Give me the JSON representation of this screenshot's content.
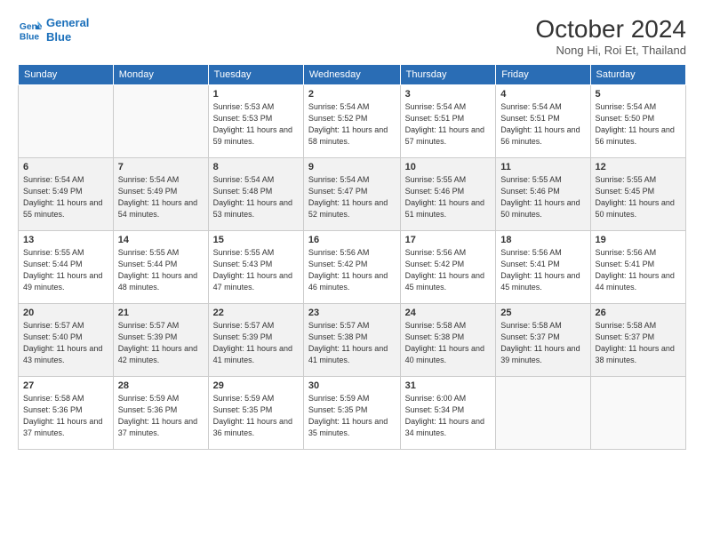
{
  "header": {
    "logo_line1": "General",
    "logo_line2": "Blue",
    "month": "October 2024",
    "location": "Nong Hi, Roi Et, Thailand"
  },
  "weekdays": [
    "Sunday",
    "Monday",
    "Tuesday",
    "Wednesday",
    "Thursday",
    "Friday",
    "Saturday"
  ],
  "weeks": [
    [
      {
        "day": "",
        "info": ""
      },
      {
        "day": "",
        "info": ""
      },
      {
        "day": "1",
        "info": "Sunrise: 5:53 AM\nSunset: 5:53 PM\nDaylight: 11 hours and 59 minutes."
      },
      {
        "day": "2",
        "info": "Sunrise: 5:54 AM\nSunset: 5:52 PM\nDaylight: 11 hours and 58 minutes."
      },
      {
        "day": "3",
        "info": "Sunrise: 5:54 AM\nSunset: 5:51 PM\nDaylight: 11 hours and 57 minutes."
      },
      {
        "day": "4",
        "info": "Sunrise: 5:54 AM\nSunset: 5:51 PM\nDaylight: 11 hours and 56 minutes."
      },
      {
        "day": "5",
        "info": "Sunrise: 5:54 AM\nSunset: 5:50 PM\nDaylight: 11 hours and 56 minutes."
      }
    ],
    [
      {
        "day": "6",
        "info": "Sunrise: 5:54 AM\nSunset: 5:49 PM\nDaylight: 11 hours and 55 minutes."
      },
      {
        "day": "7",
        "info": "Sunrise: 5:54 AM\nSunset: 5:49 PM\nDaylight: 11 hours and 54 minutes."
      },
      {
        "day": "8",
        "info": "Sunrise: 5:54 AM\nSunset: 5:48 PM\nDaylight: 11 hours and 53 minutes."
      },
      {
        "day": "9",
        "info": "Sunrise: 5:54 AM\nSunset: 5:47 PM\nDaylight: 11 hours and 52 minutes."
      },
      {
        "day": "10",
        "info": "Sunrise: 5:55 AM\nSunset: 5:46 PM\nDaylight: 11 hours and 51 minutes."
      },
      {
        "day": "11",
        "info": "Sunrise: 5:55 AM\nSunset: 5:46 PM\nDaylight: 11 hours and 50 minutes."
      },
      {
        "day": "12",
        "info": "Sunrise: 5:55 AM\nSunset: 5:45 PM\nDaylight: 11 hours and 50 minutes."
      }
    ],
    [
      {
        "day": "13",
        "info": "Sunrise: 5:55 AM\nSunset: 5:44 PM\nDaylight: 11 hours and 49 minutes."
      },
      {
        "day": "14",
        "info": "Sunrise: 5:55 AM\nSunset: 5:44 PM\nDaylight: 11 hours and 48 minutes."
      },
      {
        "day": "15",
        "info": "Sunrise: 5:55 AM\nSunset: 5:43 PM\nDaylight: 11 hours and 47 minutes."
      },
      {
        "day": "16",
        "info": "Sunrise: 5:56 AM\nSunset: 5:42 PM\nDaylight: 11 hours and 46 minutes."
      },
      {
        "day": "17",
        "info": "Sunrise: 5:56 AM\nSunset: 5:42 PM\nDaylight: 11 hours and 45 minutes."
      },
      {
        "day": "18",
        "info": "Sunrise: 5:56 AM\nSunset: 5:41 PM\nDaylight: 11 hours and 45 minutes."
      },
      {
        "day": "19",
        "info": "Sunrise: 5:56 AM\nSunset: 5:41 PM\nDaylight: 11 hours and 44 minutes."
      }
    ],
    [
      {
        "day": "20",
        "info": "Sunrise: 5:57 AM\nSunset: 5:40 PM\nDaylight: 11 hours and 43 minutes."
      },
      {
        "day": "21",
        "info": "Sunrise: 5:57 AM\nSunset: 5:39 PM\nDaylight: 11 hours and 42 minutes."
      },
      {
        "day": "22",
        "info": "Sunrise: 5:57 AM\nSunset: 5:39 PM\nDaylight: 11 hours and 41 minutes."
      },
      {
        "day": "23",
        "info": "Sunrise: 5:57 AM\nSunset: 5:38 PM\nDaylight: 11 hours and 41 minutes."
      },
      {
        "day": "24",
        "info": "Sunrise: 5:58 AM\nSunset: 5:38 PM\nDaylight: 11 hours and 40 minutes."
      },
      {
        "day": "25",
        "info": "Sunrise: 5:58 AM\nSunset: 5:37 PM\nDaylight: 11 hours and 39 minutes."
      },
      {
        "day": "26",
        "info": "Sunrise: 5:58 AM\nSunset: 5:37 PM\nDaylight: 11 hours and 38 minutes."
      }
    ],
    [
      {
        "day": "27",
        "info": "Sunrise: 5:58 AM\nSunset: 5:36 PM\nDaylight: 11 hours and 37 minutes."
      },
      {
        "day": "28",
        "info": "Sunrise: 5:59 AM\nSunset: 5:36 PM\nDaylight: 11 hours and 37 minutes."
      },
      {
        "day": "29",
        "info": "Sunrise: 5:59 AM\nSunset: 5:35 PM\nDaylight: 11 hours and 36 minutes."
      },
      {
        "day": "30",
        "info": "Sunrise: 5:59 AM\nSunset: 5:35 PM\nDaylight: 11 hours and 35 minutes."
      },
      {
        "day": "31",
        "info": "Sunrise: 6:00 AM\nSunset: 5:34 PM\nDaylight: 11 hours and 34 minutes."
      },
      {
        "day": "",
        "info": ""
      },
      {
        "day": "",
        "info": ""
      }
    ]
  ]
}
